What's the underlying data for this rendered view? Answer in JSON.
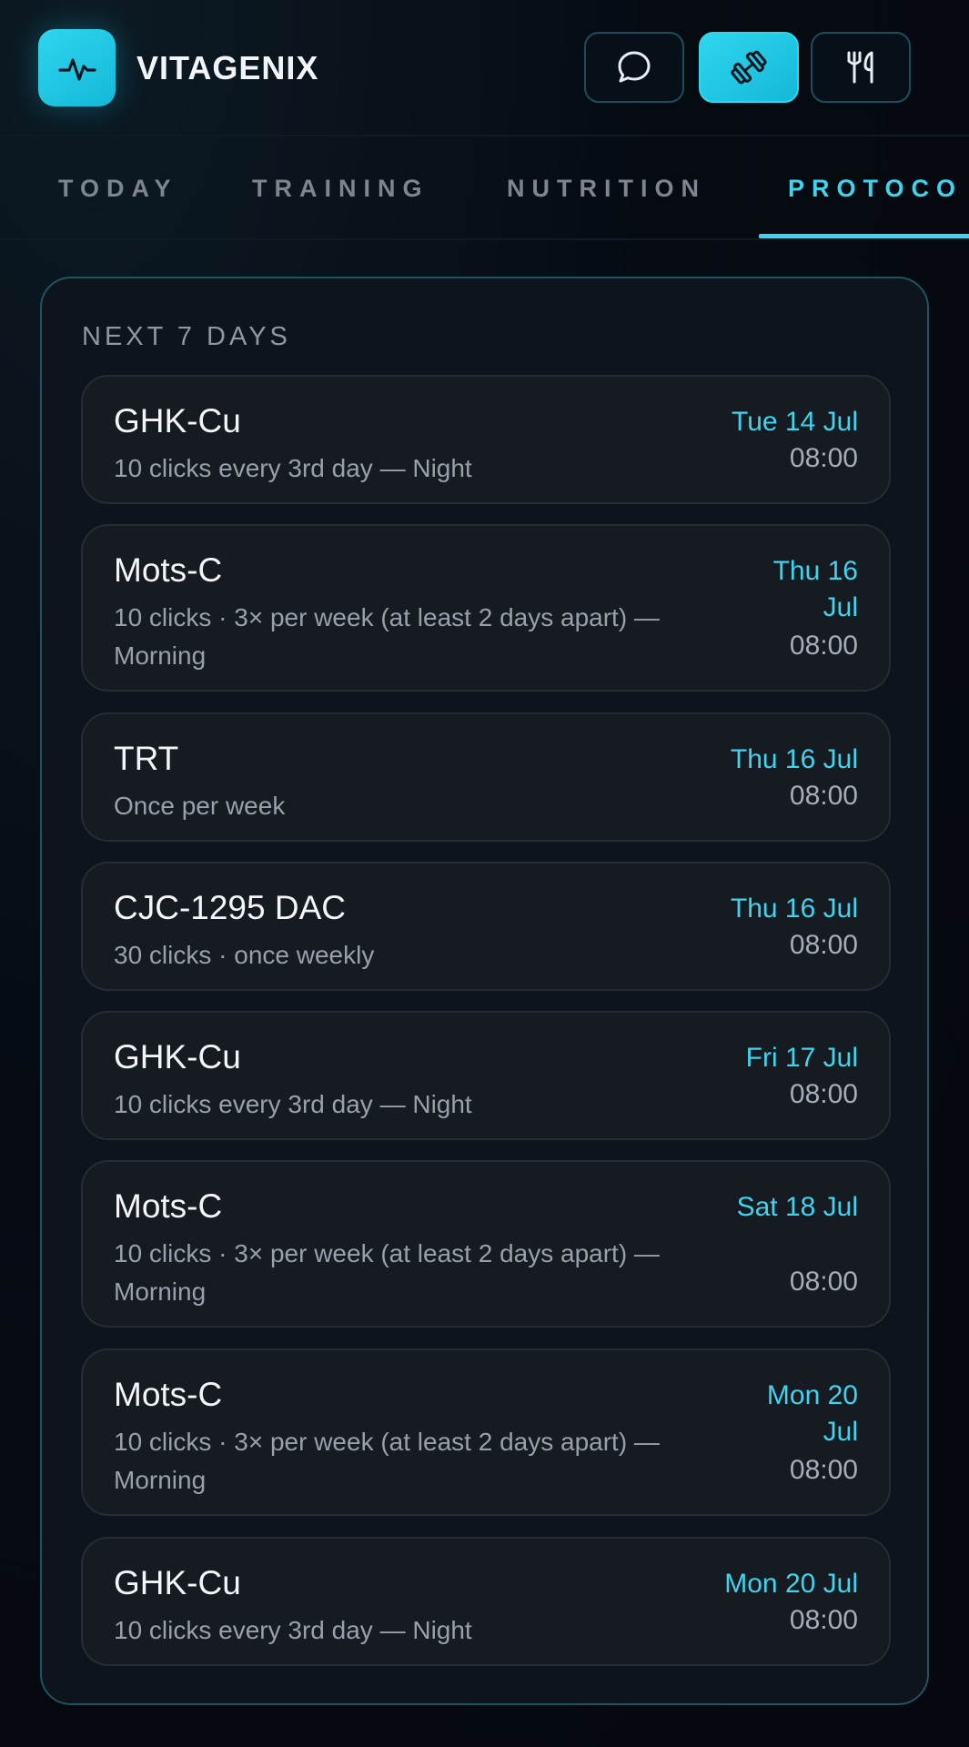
{
  "app": {
    "title": "VITAGENIX"
  },
  "header": {
    "buttons": [
      {
        "icon": "chat-bubble-icon",
        "active": false
      },
      {
        "icon": "dumbbell-icon",
        "active": true
      },
      {
        "icon": "fork-knife-icon",
        "active": false
      }
    ]
  },
  "tabs": [
    {
      "label": "TODAY",
      "active": false
    },
    {
      "label": "TRAINING",
      "active": false
    },
    {
      "label": "NUTRITION",
      "active": false
    },
    {
      "label": "PROTOCO",
      "active": true
    }
  ],
  "section": {
    "title": "NEXT 7 DAYS"
  },
  "schedule": [
    {
      "name": "GHK-Cu",
      "desc": "10 clicks every 3rd day — Night",
      "date": "Tue 14 Jul",
      "time": "08:00"
    },
    {
      "name": "Mots-C",
      "desc": "10 clicks · 3× per week (at least 2 days apart) — Morning",
      "date": "Thu 16 Jul",
      "time": "08:00"
    },
    {
      "name": "TRT",
      "desc": "Once per week",
      "date": "Thu 16 Jul",
      "time": "08:00"
    },
    {
      "name": "CJC-1295 DAC",
      "desc": "30 clicks · once weekly",
      "date": "Thu 16 Jul",
      "time": "08:00"
    },
    {
      "name": "GHK-Cu",
      "desc": "10 clicks every 3rd day — Night",
      "date": "Fri 17 Jul",
      "time": "08:00"
    },
    {
      "name": "Mots-C",
      "desc": "10 clicks · 3× per week (at least 2 days apart) — Morning",
      "date": "Sat 18 Jul",
      "time": "08:00"
    },
    {
      "name": "Mots-C",
      "desc": "10 clicks · 3× per week (at least 2 days apart) — Morning",
      "date": "Mon 20 Jul",
      "time": "08:00"
    },
    {
      "name": "GHK-Cu",
      "desc": "10 clicks every 3rd day — Night",
      "date": "Mon 20 Jul",
      "time": "08:00"
    }
  ],
  "colors": {
    "accent": "#3fd3ee",
    "background": "#060b12",
    "card": "#161b22",
    "panel_border": "#1f5463"
  }
}
